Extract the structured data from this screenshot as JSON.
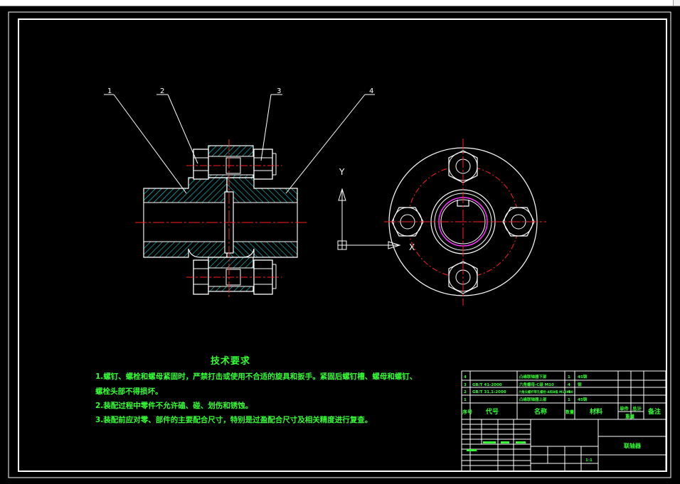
{
  "drawing": {
    "part_labels": [
      "1",
      "2",
      "3",
      "4"
    ],
    "axis_labels": {
      "y": "Y",
      "x": "X"
    },
    "colors": {
      "background": "#000000",
      "outline": "#ffffff",
      "hatch": "#00ffff",
      "centerline": "#ff2020",
      "text": "#33ff33",
      "bore": "#ff33ff"
    }
  },
  "technical_requirements": {
    "title": "技术要求",
    "items": [
      "1.螺钉、螺栓和螺母紧固时，严禁打击或使用不合适的旋具和扳手。紧固后螺钉槽、螺母和螺钉、",
      "螺栓头部不得损坏。",
      "2.装配过程中零件不允许磕、碰、划伤和锈蚀。",
      "3.装配前应对零、部件的主要配合尺寸，特别是过盈配合尺寸及相关精度进行复查。"
    ]
  },
  "title_block": {
    "rows": [
      {
        "seq": "4",
        "code": "",
        "name": "凸缘联轴器下部",
        "qty": "1",
        "material": "45钢"
      },
      {
        "seq": "3",
        "code": "GB/T 41-2000",
        "name": "六角螺母-C级 M10",
        "qty": "4",
        "material": "钢"
      },
      {
        "seq": "2",
        "code": "GB/T 31.1-2000",
        "name": "六角头螺杆带孔螺栓-A和B级 M10X30",
        "qty": "4",
        "material": ""
      },
      {
        "seq": "1",
        "code": "",
        "name": "凸缘联轴器上部",
        "qty": "1",
        "material": "45钢"
      }
    ],
    "headers": {
      "seq": "序号",
      "code": "代号",
      "name": "名称",
      "qty": "数量",
      "material": "材料",
      "unit": "单件",
      "total": "总计",
      "weight": "重量",
      "remark": "备注"
    },
    "drawing_name": "联轴器",
    "scale": "1:1"
  }
}
